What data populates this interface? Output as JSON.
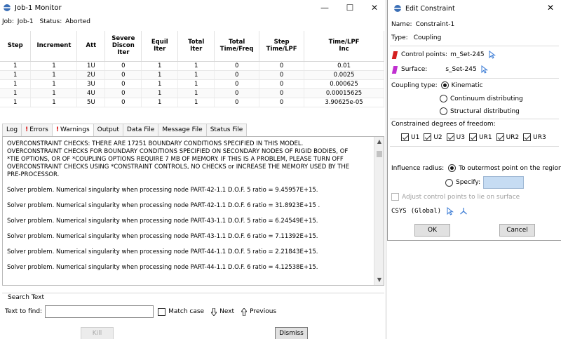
{
  "job_window": {
    "title": "Job-1 Monitor",
    "controls": {
      "minimize": "—",
      "maximize": "☐",
      "close": "✕"
    },
    "job_label": "Job:",
    "job_name": "Job-1",
    "status_label": "Status:",
    "status_value": "Aborted",
    "table": {
      "headers": [
        "Step",
        "Increment",
        "Att",
        "Severe\nDiscon\nIter",
        "Equil\nIter",
        "Total\nIter",
        "Total\nTime/Freq",
        "Step\nTime/LPF",
        "Time/LPF\nInc"
      ],
      "rows": [
        [
          "1",
          "1",
          "1U",
          "0",
          "1",
          "1",
          "0",
          "0",
          "0.01"
        ],
        [
          "1",
          "1",
          "2U",
          "0",
          "1",
          "1",
          "0",
          "0",
          "0.0025"
        ],
        [
          "1",
          "1",
          "3U",
          "0",
          "1",
          "1",
          "0",
          "0",
          "0.000625"
        ],
        [
          "1",
          "1",
          "4U",
          "0",
          "1",
          "1",
          "0",
          "0",
          "0.00015625"
        ],
        [
          "1",
          "1",
          "5U",
          "0",
          "1",
          "1",
          "0",
          "0",
          "3.90625e-05"
        ]
      ]
    },
    "tabs": {
      "log": "Log",
      "errors_mark": "!",
      "errors": "Errors",
      "warnings_mark": "!",
      "warnings": "Warnings",
      "output": "Output",
      "data_file": "Data File",
      "message_file": "Message File",
      "status_file": "Status File"
    },
    "log_text": "OVERCONSTRAINT CHECKS: THERE ARE 17251 BOUNDARY CONDITIONS SPECIFIED IN THIS MODEL.\nOVERCONSTRAINT CHECKS FOR BOUNDARY CONDITIONS SPECIFIED ON SECONDARY NODES OF RIGID BODIES, OF\n*TIE OPTIONS, OR OF *COUPLING OPTIONS REQUIRE 7 MB OF MEMORY. IF THIS IS A PROBLEM, PLEASE TURN OFF\nOVERCONSTRAINT CHECKS USING *CONSTRAINT CONTROLS, NO CHECKS or INCREASE THE MEMORY USED BY THE\nPRE-PROCESSOR.\n\nSolver problem. Numerical singularity when processing node PART-42-1.1 D.O.F. 5 ratio = 9.45957E+15.\n\nSolver problem. Numerical singularity when processing node PART-42-1.1 D.O.F. 6 ratio = 31.8923E+15 .\n\nSolver problem. Numerical singularity when processing node PART-43-1.1 D.O.F. 5 ratio = 6.24549E+15.\n\nSolver problem. Numerical singularity when processing node PART-43-1.1 D.O.F. 6 ratio = 7.11392E+15.\n\nSolver problem. Numerical singularity when processing node PART-44-1.1 D.O.F. 5 ratio = 2.21843E+15.\n\nSolver problem. Numerical singularity when processing node PART-44-1.1 D.O.F. 6 ratio = 4.12538E+15.",
    "search": {
      "title": "Search Text",
      "find_label": "Text to find:",
      "find_value": "",
      "match_case": "Match case",
      "next": "Next",
      "previous": "Previous"
    },
    "buttons": {
      "kill": "Kill",
      "dismiss": "Dismiss"
    }
  },
  "dialog": {
    "title": "Edit Constraint",
    "close": "✕",
    "name_label": "Name:",
    "name_value": "Constraint-1",
    "type_label": "Type:",
    "type_value": "Coupling",
    "control_points_label": "Control points:",
    "control_points_value": "m_Set-245",
    "surface_label": "Surface:",
    "surface_value": "s_Set-245",
    "coupling_type_label": "Coupling type:",
    "coupling_options": [
      "Kinematic",
      "Continuum distributing",
      "Structural distributing"
    ],
    "dof_label": "Constrained degrees of freedom:",
    "dof": [
      "U1",
      "U2",
      "U3",
      "UR1",
      "UR2",
      "UR3"
    ],
    "influence_label": "Influence radius:",
    "influence_option": "To outermost point on the region",
    "specify_label": "Specify:",
    "specify_value": "",
    "adjust_label": "Adjust control points to lie on surface",
    "csys_label": "CSYS",
    "csys_value": "(Global)",
    "ok": "OK",
    "cancel": "Cancel",
    "colors": {
      "control_points": "#d42020",
      "surface": "#c030d0",
      "arrow": "#3a7bd5"
    }
  }
}
